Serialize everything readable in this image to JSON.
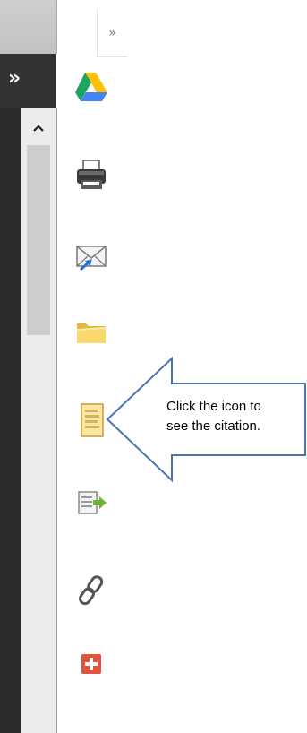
{
  "toolbar": {
    "collapse_glyph": "»",
    "items": [
      {
        "name": "google-drive",
        "icon": "google-drive-icon"
      },
      {
        "name": "print",
        "icon": "printer-icon"
      },
      {
        "name": "email",
        "icon": "email-icon"
      },
      {
        "name": "save-to-folder",
        "icon": "folder-icon"
      },
      {
        "name": "cite",
        "icon": "citation-icon"
      },
      {
        "name": "export",
        "icon": "export-icon"
      },
      {
        "name": "permalink",
        "icon": "link-icon"
      },
      {
        "name": "add",
        "icon": "plus-icon"
      }
    ]
  },
  "callout": {
    "line1": "Click the icon to",
    "line2": "see the citation."
  },
  "colors": {
    "callout_stroke": "#4a74b4",
    "dark_panel": "#333333",
    "plus_red": "#e0533c"
  }
}
